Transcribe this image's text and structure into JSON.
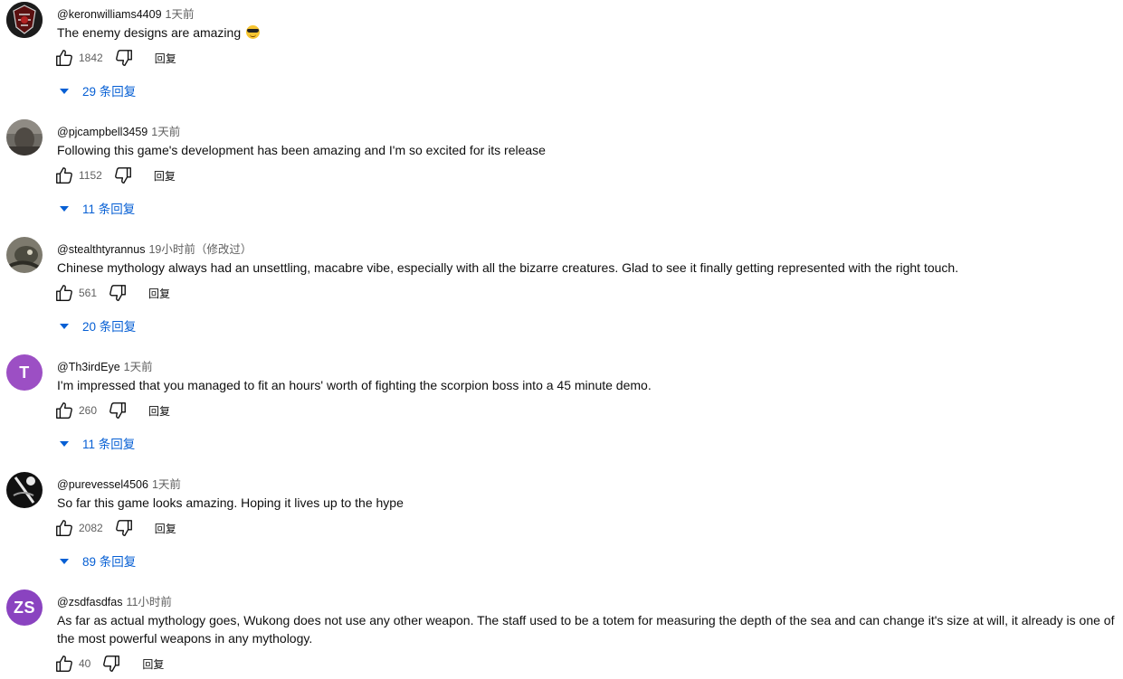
{
  "colors": {
    "link_blue": "#065fd4",
    "muted": "#606060",
    "avatar_T": "#9c4fc4",
    "avatar_ZS": "#8a43c0"
  },
  "comments": [
    {
      "author": "@keronwilliams4409",
      "time": "1天前",
      "text": "The enemy designs are amazing",
      "emoji": "sunglasses-emoji",
      "likes": "1842",
      "reply_label": "回复",
      "replies_label": "29 条回复",
      "avatar_icon": "avatar-image"
    },
    {
      "author": "@pjcampbell3459",
      "time": "1天前",
      "text": "Following this game's development has been amazing and I'm so excited for its release",
      "likes": "1152",
      "reply_label": "回复",
      "replies_label": "11 条回复",
      "avatar_icon": "avatar-image"
    },
    {
      "author": "@stealthtyrannus",
      "time": "19小时前（修改过）",
      "text": "Chinese mythology always had an unsettling, macabre vibe, especially with all the bizarre creatures. Glad to see it finally getting represented with the right touch.",
      "likes": "561",
      "reply_label": "回复",
      "replies_label": "20 条回复",
      "avatar_icon": "avatar-image"
    },
    {
      "author": "@Th3irdEye",
      "time": "1天前",
      "text": "I'm impressed that you managed to fit an hours' worth of fighting the scorpion boss into a 45 minute demo.",
      "likes": "260",
      "reply_label": "回复",
      "replies_label": "11 条回复",
      "avatar_letter": "T"
    },
    {
      "author": "@purevessel4506",
      "time": "1天前",
      "text": "So far this game looks amazing. Hoping it lives up to the hype",
      "likes": "2082",
      "reply_label": "回复",
      "replies_label": "89 条回复",
      "avatar_icon": "avatar-image"
    },
    {
      "author": "@zsdfasdfas",
      "time": "11小时前",
      "text": "As far as actual mythology goes, Wukong does not use any other weapon. The staff used to be a totem for measuring the depth of the sea and can change it's size at will, it already is one of the most powerful weapons in any mythology.",
      "likes": "40",
      "reply_label": "回复",
      "avatar_letter": "ZS"
    }
  ]
}
